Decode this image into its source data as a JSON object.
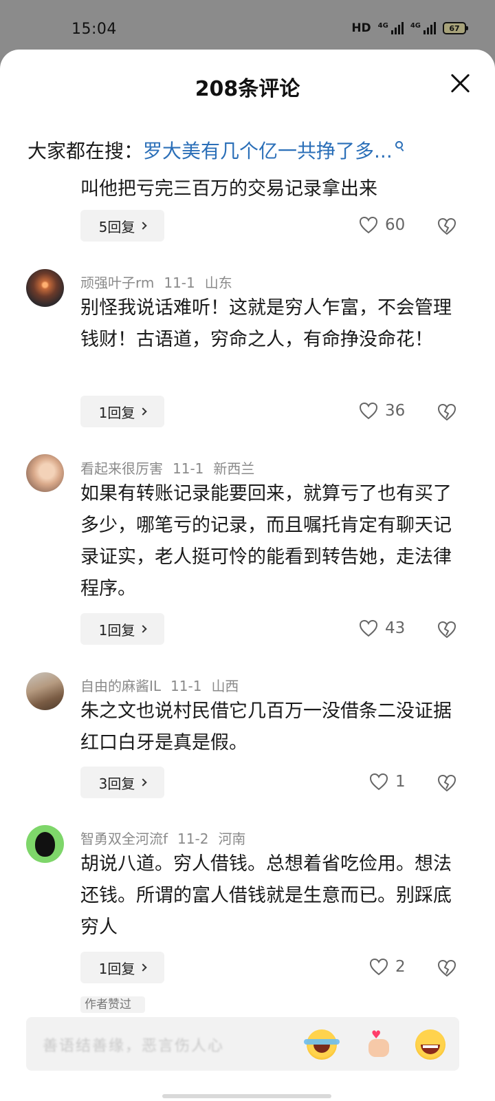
{
  "status_bar": {
    "time": "15:04",
    "hd": "HD",
    "signal_1": "4G",
    "signal_2": "4G",
    "battery": "67"
  },
  "sheet": {
    "title": "208条评论"
  },
  "search_hint": {
    "prefix": "大家都在搜：",
    "query": "罗大美有几个亿一共挣了多..."
  },
  "comments": [
    {
      "text": "叫他把亏完三百万的交易记录拿出来",
      "replies": "5回复",
      "likes": "60"
    },
    {
      "user": "顽强叶子rm",
      "date": "11-1",
      "location": "山东",
      "text": "别怪我说话难听！这就是穷人乍富，不会管理钱财！古语道，穷命之人，有命挣没命花！",
      "replies": "1回复",
      "likes": "36"
    },
    {
      "user": "看起来很厉害",
      "date": "11-1",
      "location": "新西兰",
      "text": "如果有转账记录能要回来，就算亏了也有买了多少，哪笔亏的记录，而且嘱托肯定有聊天记录证实，老人挺可怜的能看到转告她，走法律程序。",
      "replies": "1回复",
      "likes": "43"
    },
    {
      "user": "自由的麻酱IL",
      "date": "11-1",
      "location": "山西",
      "text": "朱之文也说村民借它几百万一没借条二没证据红口白牙是真是假。",
      "replies": "3回复",
      "likes": "1"
    },
    {
      "user": "智勇双全河流f",
      "date": "11-2",
      "location": "河南",
      "text": "胡说八道。穷人借钱。总想着省吃俭用。想法还钱。所谓的富人借钱就是生意而已。别踩底穷人",
      "replies": "1回复",
      "likes": "2",
      "badge": "作者赞过"
    }
  ],
  "composer": {
    "placeholder": "善语结善缘，恶言伤人心"
  }
}
